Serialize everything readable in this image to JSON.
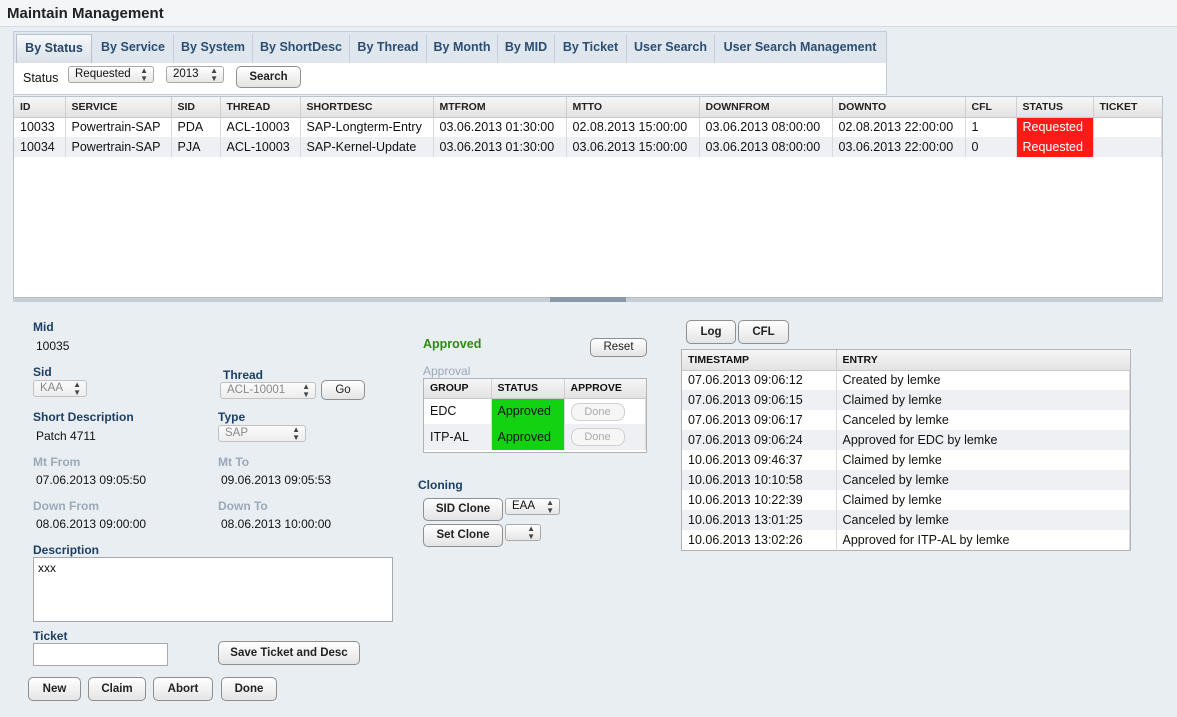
{
  "header": {
    "title": "Maintain Management"
  },
  "tabs": [
    {
      "label": "By Status",
      "active": true
    },
    {
      "label": "By Service"
    },
    {
      "label": "By System"
    },
    {
      "label": "By ShortDesc"
    },
    {
      "label": "By Thread"
    },
    {
      "label": "By Month"
    },
    {
      "label": "By MID"
    },
    {
      "label": "By Ticket"
    },
    {
      "label": "User Search"
    },
    {
      "label": "User Search Management"
    }
  ],
  "filter": {
    "status_label": "Status",
    "status_value": "Requested",
    "year_value": "2013",
    "search_label": "Search"
  },
  "main_table": {
    "columns": [
      "ID",
      "SERVICE",
      "SID",
      "THREAD",
      "SHORTDESC",
      "MTFROM",
      "MTTO",
      "DOWNFROM",
      "DOWNTO",
      "CFL",
      "STATUS",
      "TICKET"
    ],
    "rows": [
      [
        "10033",
        "Powertrain-SAP",
        "PDA",
        "ACL-10003",
        "SAP-Longterm-Entry",
        "03.06.2013 01:30:00",
        "02.08.2013 15:00:00",
        "03.06.2013 08:00:00",
        "02.08.2013 22:00:00",
        "1",
        "Requested",
        ""
      ],
      [
        "10034",
        "Powertrain-SAP",
        "PJA",
        "ACL-10003",
        "SAP-Kernel-Update",
        "03.06.2013 01:30:00",
        "03.06.2013 15:00:00",
        "03.06.2013 08:00:00",
        "03.06.2013 22:00:00",
        "0",
        "Requested",
        ""
      ]
    ],
    "status_color": "#ff1a1a"
  },
  "detail": {
    "mid_label": "Mid",
    "mid_value": "10035",
    "sid_label": "Sid",
    "sid_value": "KAA",
    "thread_label": "Thread",
    "thread_value": "ACL-10001",
    "go_label": "Go",
    "shortdesc_label": "Short Description",
    "shortdesc_value": "Patch 4711",
    "type_label": "Type",
    "type_value": "SAP",
    "mtfrom_label": "Mt From",
    "mtfrom_value": "07.06.2013 09:05:50",
    "mtto_label": "Mt To",
    "mtto_value": "09.06.2013 09:05:53",
    "downfrom_label": "Down From",
    "downfrom_value": "08.06.2013 09:00:00",
    "downto_label": "Down To",
    "downto_value": "08.06.2013 10:00:00",
    "description_label": "Description",
    "description_value": "xxx",
    "ticket_label": "Ticket",
    "ticket_value": "",
    "save_label": "Save Ticket and Desc",
    "new_label": "New",
    "claim_label": "Claim",
    "abort_label": "Abort",
    "done_label": "Done"
  },
  "approval": {
    "state_label": "Approved",
    "state_color": "#2f8a12",
    "reset_label": "Reset",
    "section_label": "Approval",
    "columns": [
      "GROUP",
      "STATUS",
      "APPROVE"
    ],
    "rows": [
      {
        "group": "EDC",
        "status": "Approved",
        "approve": "Done"
      },
      {
        "group": "ITP-AL",
        "status": "Approved",
        "approve": "Done"
      }
    ],
    "approved_color": "#12d212"
  },
  "cloning": {
    "label": "Cloning",
    "sid_clone_label": "SID Clone",
    "sid_clone_value": "EAA",
    "set_clone_label": "Set Clone",
    "set_clone_value": ""
  },
  "log": {
    "log_tab_label": "Log",
    "cfl_tab_label": "CFL",
    "columns": [
      "TIMESTAMP",
      "ENTRY"
    ],
    "rows": [
      [
        "07.06.2013 09:06:12",
        "Created by lemke"
      ],
      [
        "07.06.2013 09:06:15",
        "Claimed by lemke"
      ],
      [
        "07.06.2013 09:06:17",
        "Canceled by lemke"
      ],
      [
        "07.06.2013 09:06:24",
        "Approved for EDC by lemke"
      ],
      [
        "10.06.2013 09:46:37",
        "Claimed by lemke"
      ],
      [
        "10.06.2013 10:10:58",
        "Canceled by lemke"
      ],
      [
        "10.06.2013 10:22:39",
        "Claimed by lemke"
      ],
      [
        "10.06.2013 13:01:25",
        "Canceled by lemke"
      ],
      [
        "10.06.2013 13:02:26",
        "Approved for ITP-AL by lemke"
      ]
    ]
  }
}
